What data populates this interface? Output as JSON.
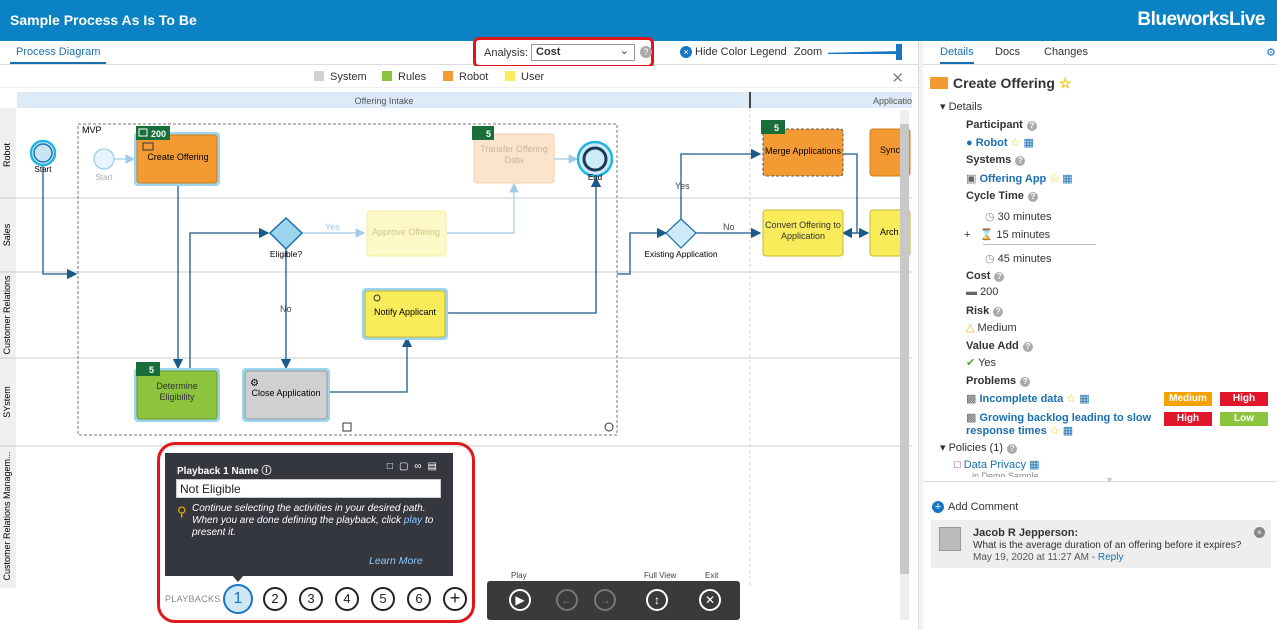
{
  "header": {
    "title": "Sample Process As Is To Be",
    "brand": "BlueworksLive"
  },
  "left_tab": "Process Diagram",
  "analysis": {
    "label": "Analysis:",
    "value": "Cost"
  },
  "toolbar": {
    "hide_legend": "Hide Color Legend",
    "zoom": "Zoom"
  },
  "legend": [
    {
      "label": "System",
      "color": "#d0d0d0"
    },
    {
      "label": "Rules",
      "color": "#8cc43d"
    },
    {
      "label": "Robot",
      "color": "#f49a33"
    },
    {
      "label": "User",
      "color": "#f8ec5a"
    }
  ],
  "diagram": {
    "phase1": "Offering Intake",
    "phase2": "Application",
    "lanes": [
      "Robot",
      "Sales",
      "Customer Relations",
      "SYstem",
      "Customer Relations Managem..."
    ],
    "group_label": "MVP",
    "events": {
      "start": "Start",
      "start2": "Start",
      "end": "End"
    },
    "tasks": {
      "create_offering": "Create Offering",
      "transfer_offering": "Transfer Offering Data",
      "approve_offering": "Approve Offering",
      "notify_applicant": "Notify Applicant",
      "determine_eligibility": "Determine Eligibility",
      "close_application": "Close Application",
      "merge_applications": "Merge Applications",
      "convert_offering": "Convert Offering to Application",
      "sync": "Sync",
      "archive": "Arch"
    },
    "gateways": {
      "eligible": "Eligible?",
      "existing": "Existing Application"
    },
    "flow_labels": {
      "yes1": "Yes",
      "no1": "No",
      "yes2": "Yes",
      "no2": "No"
    },
    "cost_badges": {
      "create_offering": "200",
      "transfer_offering": "5",
      "determine_eligibility": "5",
      "merge_applications": "5"
    }
  },
  "playback_panel": {
    "name_label": "Playback 1 Name",
    "name_value": "Not Eligible",
    "help_text": "Continue selecting the activities in your desired path. When you are done defining the playback, click",
    "help_link": "play",
    "help_tail": "to present it.",
    "learn_more": "Learn More",
    "playbacks_label": "PLAYBACKS",
    "numbers": [
      "1",
      "2",
      "3",
      "4",
      "5",
      "6"
    ],
    "selected": 1
  },
  "controls": {
    "play": "Play",
    "full_view": "Full View",
    "exit": "Exit"
  },
  "right_panel": {
    "tabs": [
      "Details",
      "Docs",
      "Changes"
    ],
    "title": "Create Offering",
    "details_section": "Details",
    "participant_label": "Participant",
    "participant_value": "Robot",
    "systems_label": "Systems",
    "systems_value": "Offering App",
    "cycle_label": "Cycle Time",
    "cycle_1": "30 minutes",
    "cycle_2": "15 minutes",
    "cycle_total": "45 minutes",
    "cost_label": "Cost",
    "cost_value": "200",
    "risk_label": "Risk",
    "risk_value": "Medium",
    "value_add_label": "Value Add",
    "value_add_value": "Yes",
    "problems_label": "Problems",
    "problems": [
      {
        "text": "Incomplete data",
        "b1": "Medium",
        "b2": "High"
      },
      {
        "text": "Growing backlog leading to slow response times",
        "b1": "High",
        "b2": "Low"
      }
    ],
    "policies_label": "Policies (1)",
    "policy_value": "Data Privacy",
    "policy_sub": "in Demo Sample",
    "add_comment": "Add Comment",
    "comment": {
      "author": "Jacob R Jepperson:",
      "text": "What is the average duration of an offering before it expires?",
      "date": "May 19, 2020 at 11:27 AM -",
      "reply": "Reply"
    }
  }
}
